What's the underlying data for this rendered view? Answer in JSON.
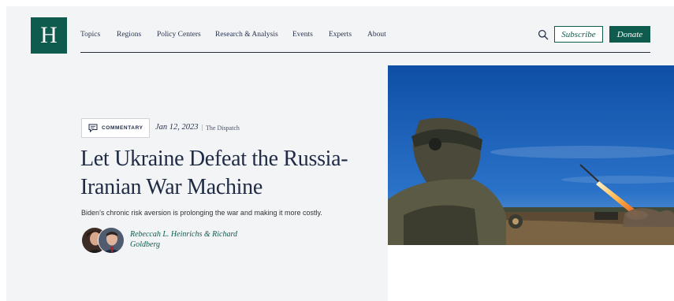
{
  "logo": {
    "letter": "H"
  },
  "nav": {
    "items": [
      "Topics",
      "Regions",
      "Policy Centers",
      "Research & Analysis",
      "Events",
      "Experts",
      "About"
    ]
  },
  "header": {
    "subscribe_label": "Subscribe",
    "donate_label": "Donate"
  },
  "article": {
    "category": "COMMENTARY",
    "date": "Jan 12, 2023",
    "separator": "|",
    "source": "The Dispatch",
    "headline_line1": "Let Ukraine Defeat the Russia-",
    "headline_line2": "Iranian War Machine",
    "dek": "Biden’s chronic risk aversion is prolonging the war and making it more costly.",
    "authors_line1": "Rebeccah L. Heinrichs & Richard",
    "authors_line2": "Goldberg"
  },
  "colors": {
    "brand": "#0f5b4d",
    "text": "#1f2a44",
    "panel": "#f3f4f6"
  }
}
